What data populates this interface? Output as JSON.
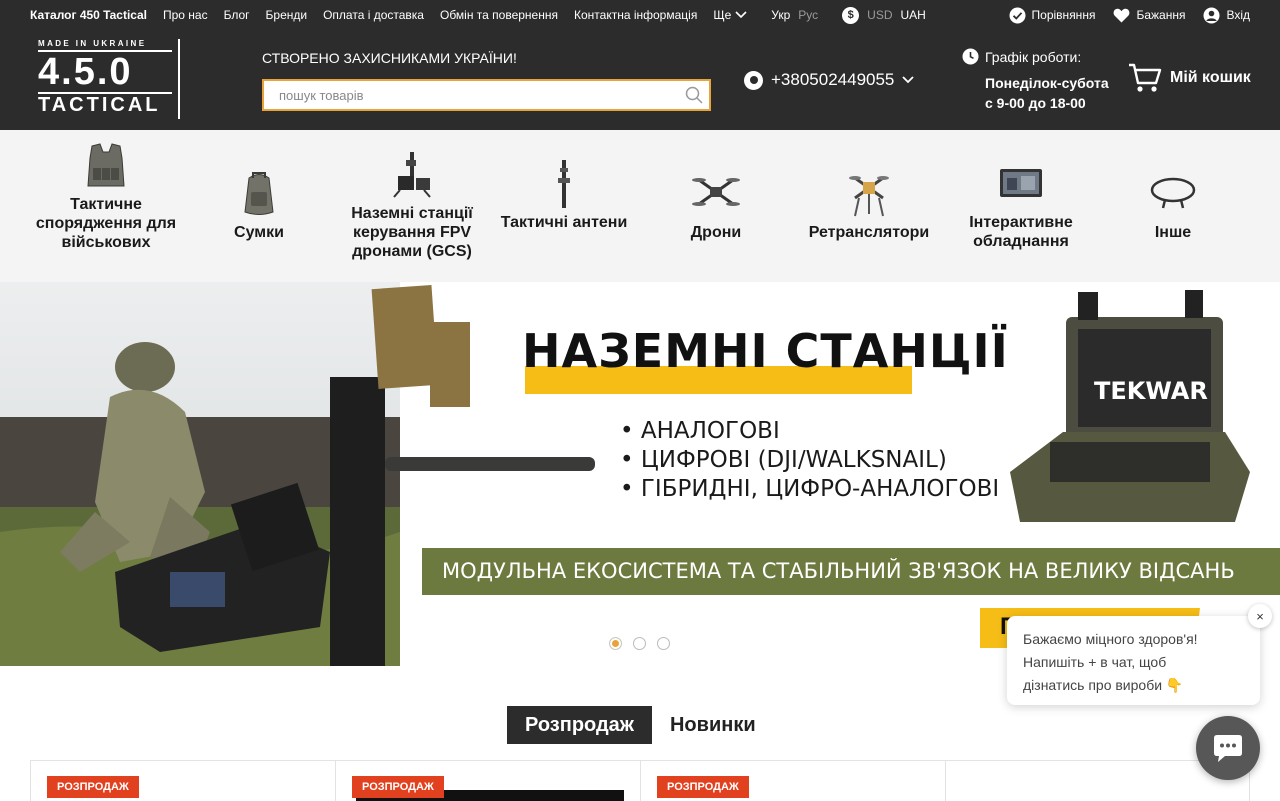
{
  "topbar": {
    "nav": [
      "Каталог 450 Tactical",
      "Про нас",
      "Блог",
      "Бренди",
      "Оплата і доставка",
      "Обмін та повернення",
      "Контактна інформація"
    ],
    "more_label": "Ще",
    "lang_active": "Укр",
    "lang_other": "Рус",
    "currency_other": "USD",
    "currency_active": "UAH",
    "compare": "Порівняння",
    "wishlist": "Бажання",
    "login": "Вхід"
  },
  "header": {
    "logo": {
      "made_in": "MADE IN UKRAINE",
      "big": "4.5.0",
      "sub": "TACTICAL"
    },
    "slogan": "СТВОРЕНО ЗАХИСНИКАМИ УКРАЇНИ!",
    "search_placeholder": "пошук товарів",
    "phone": "+380502449055",
    "schedule_title": "Графік роботи:",
    "schedule_days": "Понеділок-субота",
    "schedule_hours": "с 9-00 до 18-00",
    "cart": "Мій кошик"
  },
  "categories": [
    {
      "label": "Тактичне спорядження для військових",
      "icon": "plate-carrier-icon"
    },
    {
      "label": "Сумки",
      "icon": "backpack-icon"
    },
    {
      "label": "Наземні станції керування FPV дронами (GCS)",
      "icon": "ground-station-icon"
    },
    {
      "label": "Тактичні антени",
      "icon": "antenna-icon"
    },
    {
      "label": "Дрони",
      "icon": "drone-icon"
    },
    {
      "label": "Ретранслятори",
      "icon": "repeater-icon"
    },
    {
      "label": "Інтерактивне обладнання",
      "icon": "screen-icon"
    },
    {
      "label": "Інше",
      "icon": "cable-icon"
    }
  ],
  "banner": {
    "title": "НАЗЕМНІ СТАНЦІЇ",
    "bullets": [
      "• АНАЛОГОВІ",
      "• ЦИФРОВІ (DJI/WALKSNAIL)",
      "• ГІБРИДНІ, ЦИФРО-АНАЛОГОВІ"
    ],
    "stripe": "МОДУЛЬНА ЕКОСИСТЕМА ТА СТАБІЛЬНИЙ ЗВ'ЯЗОК НА ВЕЛИКУ ВІДСАНЬ",
    "brand": "TEKWAR",
    "button_partial": "П",
    "slides": 3,
    "active_slide": 1
  },
  "tabs": [
    "Розпродаж",
    "Новинки"
  ],
  "products": [
    {
      "badge": "РОЗПРОДАЖ"
    },
    {
      "badge": "РОЗПРОДАЖ"
    },
    {
      "badge": "РОЗПРОДАЖ"
    }
  ],
  "chat": {
    "line1": "Бажаємо міцного здоров'я!",
    "line2": "Напишіть + в чат, щоб",
    "line3": "дізнатись про вироби 👇",
    "close": "×"
  },
  "colors": {
    "dark": "#2c2c2c",
    "accent": "#e8a33b",
    "sale": "#e2411f",
    "olive": "#6c7a3f",
    "banner_yellow": "#f6bd16"
  }
}
